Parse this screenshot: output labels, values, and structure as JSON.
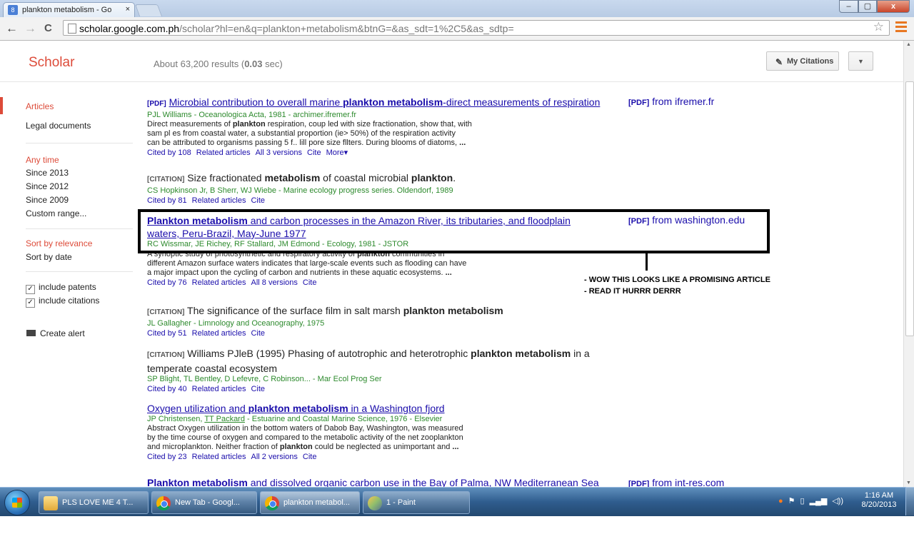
{
  "browser": {
    "tab_title": "plankton metabolism - Go",
    "tab_favicon": "8",
    "tab_close": "×",
    "window_min": "–",
    "window_max": "▢",
    "window_close": "x",
    "back_icon": "←",
    "forward_icon": "→",
    "reload_icon": "C",
    "url_host": "scholar.google.com.ph",
    "url_path": "/scholar?hl=en&q=plankton+metabolism&btnG=&as_sdt=1%2C5&as_sdtp=",
    "star_icon": "☆"
  },
  "header": {
    "logo": "Scholar",
    "results_prefix": "About 63,200 results (",
    "results_time": "0.03",
    "results_suffix": " sec)",
    "my_citations": "My Citations",
    "dropdown_icon": "▼"
  },
  "sidebar": {
    "articles": "Articles",
    "legal": "Legal documents",
    "any_time": "Any time",
    "since2013": "Since 2013",
    "since2012": "Since 2012",
    "since2009": "Since 2009",
    "custom": "Custom range...",
    "sort_rel": "Sort by relevance",
    "sort_date": "Sort by date",
    "patents": "include patents",
    "citations": "include citations",
    "check": "✓",
    "alert": "Create alert"
  },
  "results": [
    {
      "tag": "[PDF]",
      "title_a": "Microbial contribution to overall marine ",
      "title_b": "plankton metabolism",
      "title_c": "-direct measurements of respiration",
      "meta": "PJL Williams - Oceanologica Acta, 1981 - archimer.ifremer.fr",
      "snip1": "Direct measurements of ",
      "snip1b": "plankton",
      "snip1c": " respiration, coup led with size fractionation, show that, with",
      "snip2": "sam pl es from coastal water, a substantial proportion (ie> 50%) of the respiration activity",
      "snip3": "can be attributed to organisms passing 5 f.. lill pore size fllters. During blooms of diatoms, ",
      "snip3b": "...",
      "cited": "Cited by 108",
      "related": "Related articles",
      "versions": "All 3 versions",
      "cite": "Cite",
      "more": "More▾",
      "pdf_tag": "[PDF]",
      "pdf_src": " from ifremer.fr"
    },
    {
      "tag": "[CITATION]",
      "title_a": " Size fractionated ",
      "title_b": "metabolism",
      "title_c": " of coastal microbial ",
      "title_d": "plankton",
      "title_e": ".",
      "meta": "CS Hopkinson Jr, B Sherr, WJ Wiebe - Marine ecology progress series. Oldendorf, 1989",
      "cited": "Cited by 81",
      "related": "Related articles",
      "cite": "Cite"
    },
    {
      "title_a": "Plankton metabolism",
      "title_b": " and carbon processes in the Amazon River, its tributaries, and floodplain",
      "title_c": "waters, Peru-Brazil, May-June 1977",
      "meta": "RC Wissmar, JE Richey, RF Stallard, JM Edmond - Ecology, 1981 - JSTOR",
      "snip1": "A synoptic study of photosynthetic and respiratory activity of ",
      "snip1b": "plankton",
      "snip1c": " communities in",
      "snip2": "different Amazon surface waters indicates that large-scale events such as flooding can have",
      "snip3": "a major impact upon the cycling of carbon and nutrients in these aquatic ecosystems. ",
      "snip3b": "...",
      "cited": "Cited by 76",
      "related": "Related articles",
      "versions": "All 8 versions",
      "cite": "Cite",
      "pdf_tag": "[PDF]",
      "pdf_src": " from washington.edu"
    },
    {
      "tag": "[CITATION]",
      "title_a": " The significance of the surface film in salt marsh ",
      "title_b": "plankton metabolism",
      "meta": "JL Gallagher - Limnology and Oceanography, 1975",
      "cited": "Cited by 51",
      "related": "Related articles",
      "cite": "Cite"
    },
    {
      "tag": "[CITATION]",
      "title_a": " Williams PJleB (1995) Phasing of autotrophic and heterotrophic ",
      "title_b": "plankton metabolism",
      "title_c": " in a",
      "title_d": "temperate coastal ecosystem",
      "meta": "SP Blight, TL Bentley, D Lefevre, C Robinson... - Mar Ecol Prog Ser",
      "cited": "Cited by 40",
      "related": "Related articles",
      "cite": "Cite"
    },
    {
      "title_a": "Oxygen utilization and ",
      "title_b": "plankton metabolism",
      "title_c": " in a Washington fjord",
      "meta_a": "JP Christensen, ",
      "meta_b": "TT Packard",
      "meta_c": " - Estuarine and Coastal Marine Science, 1976 - Elsevier",
      "snip1": "Abstract Oxygen utilization in the bottom waters of Dabob Bay, Washington, was measured",
      "snip2": "by the time course of oxygen and compared to the metabolic activity of the net zooplankton",
      "snip3": "and microplankton. Neither fraction of ",
      "snip3b": "plankton",
      "snip3c": " could be neglected as unimportant and ",
      "snip3d": "...",
      "cited": "Cited by 23",
      "related": "Related articles",
      "versions": "All 2 versions",
      "cite": "Cite"
    },
    {
      "title_a": "Plankton metabolism",
      "title_b": " and dissolved organic carbon use in the Bay of Palma, NW Mediterranean Sea",
      "pdf_tag": "[PDF]",
      "pdf_src": " from int-res.com"
    }
  ],
  "annotation": {
    "line1": "- WOW THIS LOOKS LIKE A PROMISING ARTICLE",
    "line2": "- READ IT HURRR DERRR"
  },
  "taskbar": {
    "items": [
      "PLS LOVE ME 4 T...",
      "New Tab - Googl...",
      "plankton metabol...",
      "1 - Paint"
    ],
    "time": "1:16 AM",
    "date": "8/20/2013",
    "tray_icons": [
      "●",
      "⚑",
      "▯",
      "▂▄▆",
      "◁))"
    ]
  },
  "colors": {
    "scholar_red": "#dd4b39",
    "link_blue": "#1a0dab",
    "meta_green": "#2d8a2d"
  }
}
